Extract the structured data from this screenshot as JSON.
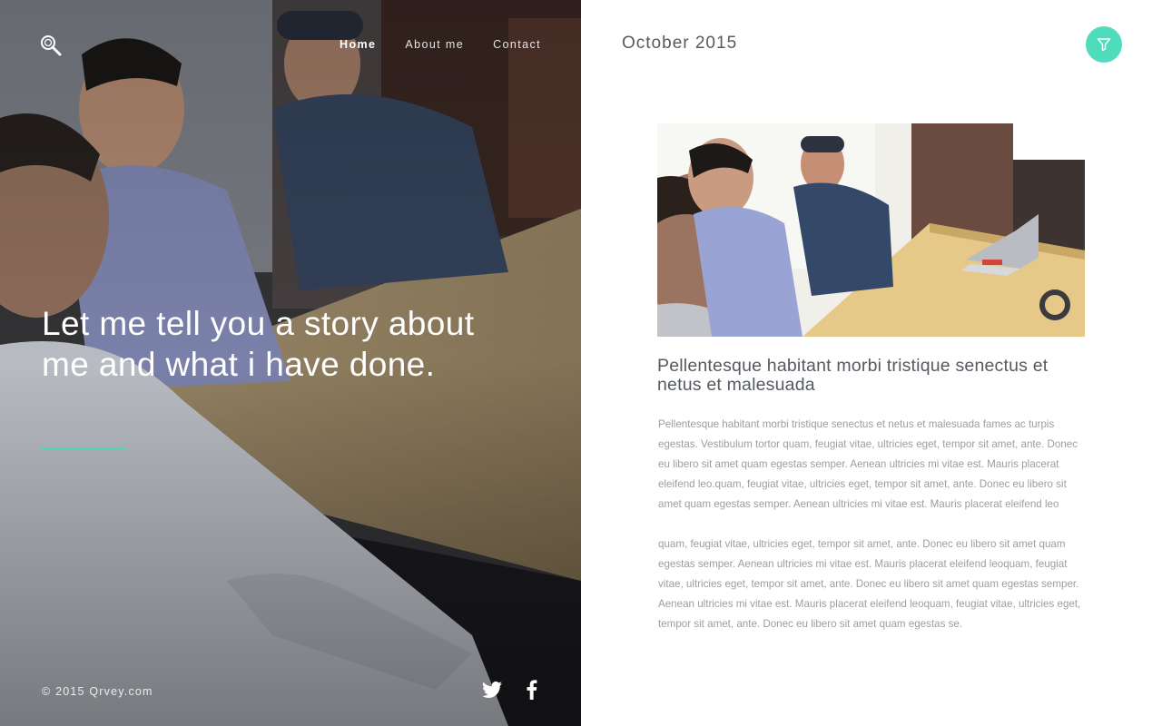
{
  "brand": {
    "accent_color": "#4fd6b7"
  },
  "hero": {
    "search_icon": "search-icon",
    "nav": [
      {
        "label": "Home",
        "active": true
      },
      {
        "label": "About me",
        "active": false
      },
      {
        "label": "Contact",
        "active": false
      }
    ],
    "headline": "Let me tell you a story about me and what i have done.",
    "copyright": "© 2015 Qrvey.com",
    "social": [
      {
        "icon": "twitter-icon"
      },
      {
        "icon": "facebook-icon"
      }
    ]
  },
  "content": {
    "date": "October 2015",
    "filter_icon": "filter-icon",
    "post": {
      "title": "Pellentesque habitant morbi tristique senectus et netus et malesuada",
      "paragraphs": [
        "Pellentesque habitant morbi tristique senectus et netus et malesuada fames ac turpis egestas. Vestibulum tortor quam, feugiat vitae, ultricies eget, tempor sit amet, ante. Donec eu libero sit amet quam egestas semper. Aenean ultricies mi vitae est. Mauris placerat eleifend leo.quam, feugiat vitae, ultricies eget, tempor sit amet, ante. Donec eu libero sit amet quam egestas semper. Aenean ultricies mi vitae est. Mauris placerat eleifend leo",
        "quam, feugiat vitae, ultricies eget, tempor sit amet, ante. Donec eu libero sit amet quam egestas semper. Aenean ultricies mi vitae est. Mauris placerat eleifend leoquam, feugiat vitae, ultricies eget, tempor sit amet, ante. Donec eu libero sit amet quam egestas semper. Aenean ultricies mi vitae est. Mauris placerat eleifend leoquam, feugiat vitae, ultricies eget, tempor sit amet, ante. Donec eu libero sit amet quam egestas se."
      ]
    }
  }
}
